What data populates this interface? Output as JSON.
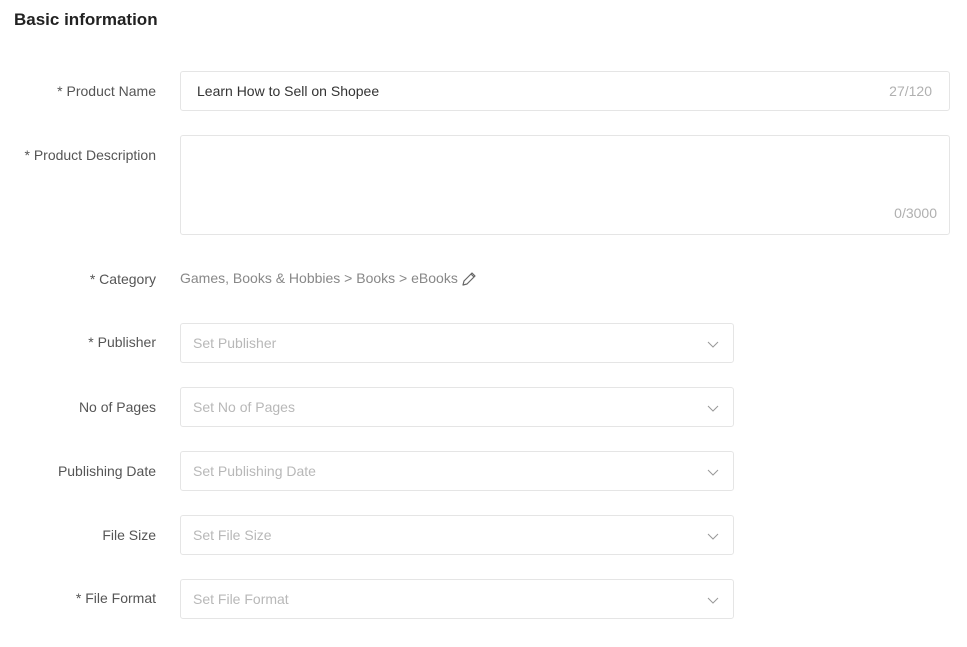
{
  "section_title": "Basic information",
  "product_name": {
    "label": "* Product Name",
    "value": "Learn How to Sell on Shopee",
    "counter": "27/120"
  },
  "product_description": {
    "label": "* Product Description",
    "value": "",
    "counter": "0/3000"
  },
  "category": {
    "label": "* Category",
    "path": "Games, Books & Hobbies > Books > eBooks",
    "edit_icon": "pencil-icon"
  },
  "attributes": [
    {
      "label": "*  Publisher",
      "placeholder": "Set Publisher"
    },
    {
      "label": "No of Pages",
      "placeholder": "Set No of Pages"
    },
    {
      "label": "Publishing Date",
      "placeholder": "Set Publishing Date"
    },
    {
      "label": "File Size",
      "placeholder": "Set File Size"
    },
    {
      "label": "*  File Format",
      "placeholder": "Set File Format"
    }
  ]
}
